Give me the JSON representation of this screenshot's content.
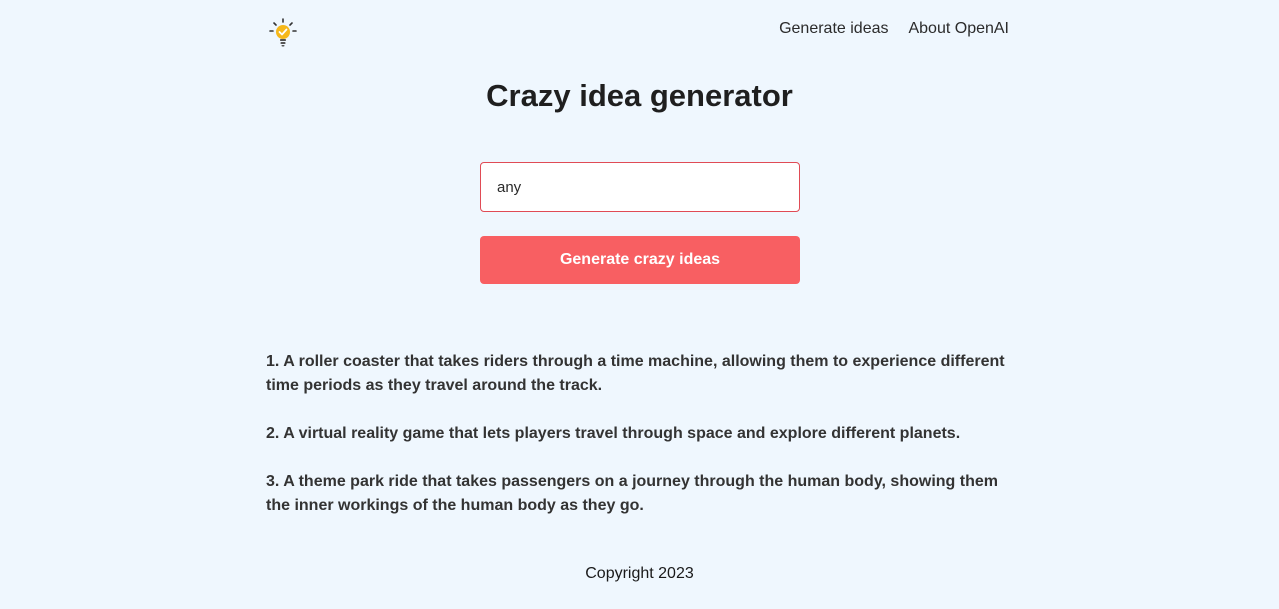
{
  "header": {
    "logo_icon": "lightbulb-check-icon",
    "nav": [
      {
        "label": "Generate ideas"
      },
      {
        "label": "About OpenAI"
      }
    ]
  },
  "main": {
    "title": "Crazy idea generator",
    "input": {
      "value": "any",
      "placeholder": ""
    },
    "button_label": "Generate crazy ideas",
    "ideas": [
      "1. A roller coaster that takes riders through a time machine, allowing them to experience different time periods as they travel around the track.",
      "2. A virtual reality game that lets players travel through space and explore different planets.",
      "3. A theme park ride that takes passengers on a journey through the human body, showing them the inner workings of the human body as they go."
    ]
  },
  "footer": {
    "text": "Copyright 2023"
  },
  "colors": {
    "background": "#eff7fe",
    "accent": "#f85f62",
    "input_border": "#e04b55",
    "logo_yellow": "#f6b81a"
  }
}
